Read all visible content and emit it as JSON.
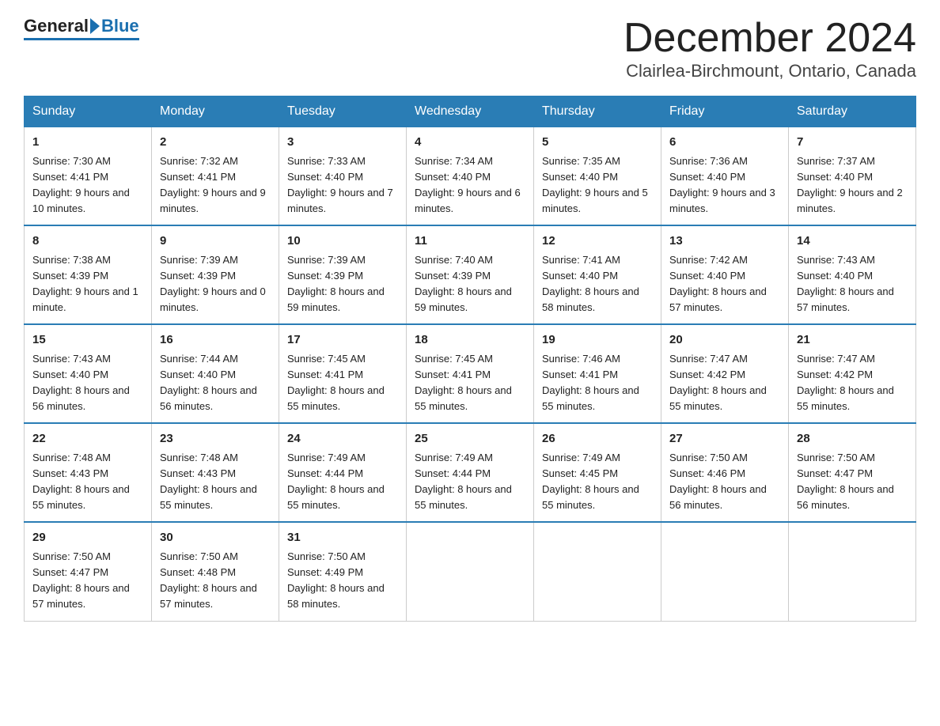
{
  "header": {
    "logo_general": "General",
    "logo_blue": "Blue",
    "month_title": "December 2024",
    "location": "Clairlea-Birchmount, Ontario, Canada"
  },
  "weekdays": [
    "Sunday",
    "Monday",
    "Tuesday",
    "Wednesday",
    "Thursday",
    "Friday",
    "Saturday"
  ],
  "weeks": [
    [
      {
        "day": "1",
        "sunrise": "7:30 AM",
        "sunset": "4:41 PM",
        "daylight": "9 hours and 10 minutes."
      },
      {
        "day": "2",
        "sunrise": "7:32 AM",
        "sunset": "4:41 PM",
        "daylight": "9 hours and 9 minutes."
      },
      {
        "day": "3",
        "sunrise": "7:33 AM",
        "sunset": "4:40 PM",
        "daylight": "9 hours and 7 minutes."
      },
      {
        "day": "4",
        "sunrise": "7:34 AM",
        "sunset": "4:40 PM",
        "daylight": "9 hours and 6 minutes."
      },
      {
        "day": "5",
        "sunrise": "7:35 AM",
        "sunset": "4:40 PM",
        "daylight": "9 hours and 5 minutes."
      },
      {
        "day": "6",
        "sunrise": "7:36 AM",
        "sunset": "4:40 PM",
        "daylight": "9 hours and 3 minutes."
      },
      {
        "day": "7",
        "sunrise": "7:37 AM",
        "sunset": "4:40 PM",
        "daylight": "9 hours and 2 minutes."
      }
    ],
    [
      {
        "day": "8",
        "sunrise": "7:38 AM",
        "sunset": "4:39 PM",
        "daylight": "9 hours and 1 minute."
      },
      {
        "day": "9",
        "sunrise": "7:39 AM",
        "sunset": "4:39 PM",
        "daylight": "9 hours and 0 minutes."
      },
      {
        "day": "10",
        "sunrise": "7:39 AM",
        "sunset": "4:39 PM",
        "daylight": "8 hours and 59 minutes."
      },
      {
        "day": "11",
        "sunrise": "7:40 AM",
        "sunset": "4:39 PM",
        "daylight": "8 hours and 59 minutes."
      },
      {
        "day": "12",
        "sunrise": "7:41 AM",
        "sunset": "4:40 PM",
        "daylight": "8 hours and 58 minutes."
      },
      {
        "day": "13",
        "sunrise": "7:42 AM",
        "sunset": "4:40 PM",
        "daylight": "8 hours and 57 minutes."
      },
      {
        "day": "14",
        "sunrise": "7:43 AM",
        "sunset": "4:40 PM",
        "daylight": "8 hours and 57 minutes."
      }
    ],
    [
      {
        "day": "15",
        "sunrise": "7:43 AM",
        "sunset": "4:40 PM",
        "daylight": "8 hours and 56 minutes."
      },
      {
        "day": "16",
        "sunrise": "7:44 AM",
        "sunset": "4:40 PM",
        "daylight": "8 hours and 56 minutes."
      },
      {
        "day": "17",
        "sunrise": "7:45 AM",
        "sunset": "4:41 PM",
        "daylight": "8 hours and 55 minutes."
      },
      {
        "day": "18",
        "sunrise": "7:45 AM",
        "sunset": "4:41 PM",
        "daylight": "8 hours and 55 minutes."
      },
      {
        "day": "19",
        "sunrise": "7:46 AM",
        "sunset": "4:41 PM",
        "daylight": "8 hours and 55 minutes."
      },
      {
        "day": "20",
        "sunrise": "7:47 AM",
        "sunset": "4:42 PM",
        "daylight": "8 hours and 55 minutes."
      },
      {
        "day": "21",
        "sunrise": "7:47 AM",
        "sunset": "4:42 PM",
        "daylight": "8 hours and 55 minutes."
      }
    ],
    [
      {
        "day": "22",
        "sunrise": "7:48 AM",
        "sunset": "4:43 PM",
        "daylight": "8 hours and 55 minutes."
      },
      {
        "day": "23",
        "sunrise": "7:48 AM",
        "sunset": "4:43 PM",
        "daylight": "8 hours and 55 minutes."
      },
      {
        "day": "24",
        "sunrise": "7:49 AM",
        "sunset": "4:44 PM",
        "daylight": "8 hours and 55 minutes."
      },
      {
        "day": "25",
        "sunrise": "7:49 AM",
        "sunset": "4:44 PM",
        "daylight": "8 hours and 55 minutes."
      },
      {
        "day": "26",
        "sunrise": "7:49 AM",
        "sunset": "4:45 PM",
        "daylight": "8 hours and 55 minutes."
      },
      {
        "day": "27",
        "sunrise": "7:50 AM",
        "sunset": "4:46 PM",
        "daylight": "8 hours and 56 minutes."
      },
      {
        "day": "28",
        "sunrise": "7:50 AM",
        "sunset": "4:47 PM",
        "daylight": "8 hours and 56 minutes."
      }
    ],
    [
      {
        "day": "29",
        "sunrise": "7:50 AM",
        "sunset": "4:47 PM",
        "daylight": "8 hours and 57 minutes."
      },
      {
        "day": "30",
        "sunrise": "7:50 AM",
        "sunset": "4:48 PM",
        "daylight": "8 hours and 57 minutes."
      },
      {
        "day": "31",
        "sunrise": "7:50 AM",
        "sunset": "4:49 PM",
        "daylight": "8 hours and 58 minutes."
      },
      null,
      null,
      null,
      null
    ]
  ]
}
